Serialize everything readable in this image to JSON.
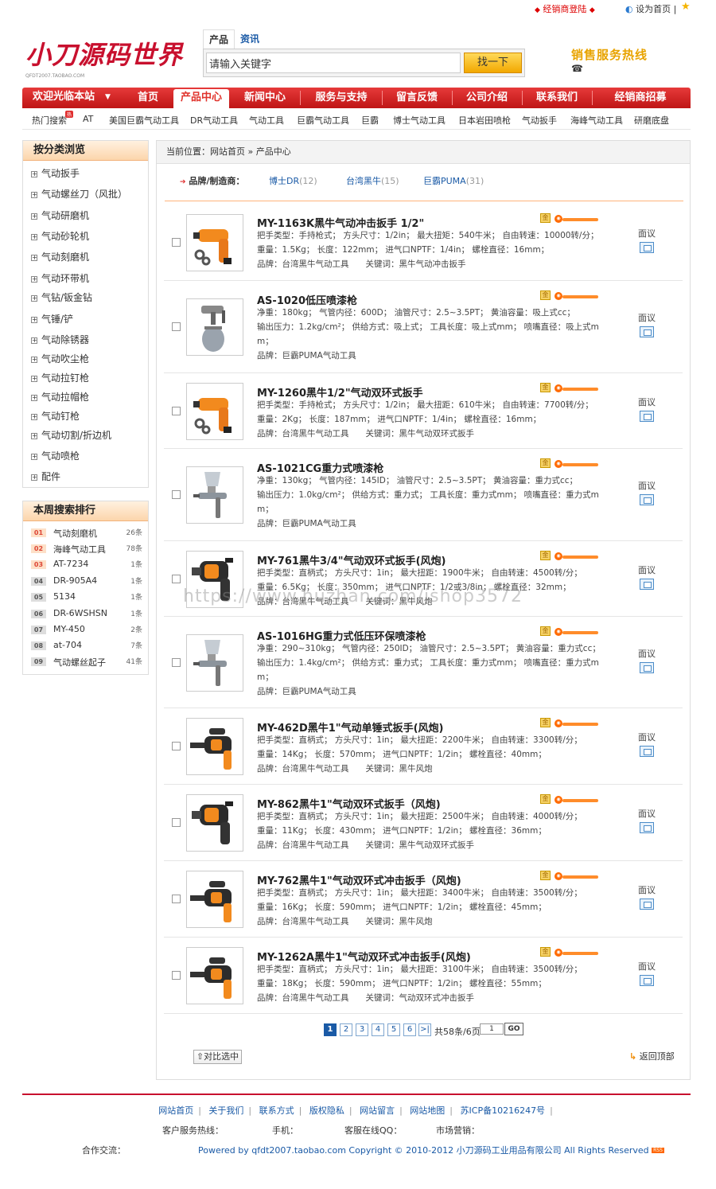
{
  "topbar": {
    "dealer": "经销商登陆",
    "set_home": "设为首页",
    "sep": "|"
  },
  "logo": {
    "title": "小刀源码世界",
    "sub": "QFDT2007.TAOBAO.COM"
  },
  "search": {
    "tab_product": "产品",
    "tab_news": "资讯",
    "placeholder": "请输入关键字",
    "button": "找一下"
  },
  "hotline": {
    "label": "销售服务热线"
  },
  "nav": {
    "welcome": "欢迎光临本站",
    "items": [
      "首页",
      "产品中心",
      "新闻中心",
      "服务与支持",
      "留言反馈",
      "公司介绍",
      "联系我们",
      "经销商招募"
    ]
  },
  "hot_search": {
    "label": "热门搜索",
    "badge": "热",
    "keywords": [
      "AT",
      "美国巨霸气动工具",
      "DR气动工具",
      "气动工具",
      "巨霸气动工具",
      "巨霸",
      "博士气动工具",
      "日本岩田喷枪",
      "气动扳手",
      "海峰气动工具",
      "研磨底盘"
    ]
  },
  "categories": {
    "title": "按分类浏览",
    "items": [
      "气动扳手",
      "气动螺丝刀（风批）",
      "气动研磨机",
      "气动砂轮机",
      "气动刻磨机",
      "气动环带机",
      "气钻/钣金钻",
      "气锤/铲",
      "气动除锈器",
      "气动吹尘枪",
      "气动拉钉枪",
      "气动拉帽枪",
      "气动钉枪",
      "气动切割/折边机",
      "气动喷枪",
      "配件"
    ]
  },
  "ranking": {
    "title": "本周搜索排行",
    "items": [
      {
        "n": "01",
        "w": "气动刻磨机",
        "c": "26条"
      },
      {
        "n": "02",
        "w": "海峰气动工具",
        "c": "78条"
      },
      {
        "n": "03",
        "w": "AT-7234",
        "c": "1条"
      },
      {
        "n": "04",
        "w": "DR-905A4",
        "c": "1条"
      },
      {
        "n": "05",
        "w": "5134",
        "c": "1条"
      },
      {
        "n": "06",
        "w": "DR-6WSHSN",
        "c": "1条"
      },
      {
        "n": "07",
        "w": "MY-450",
        "c": "2条"
      },
      {
        "n": "08",
        "w": "at-704",
        "c": "7条"
      },
      {
        "n": "09",
        "w": "气动螺丝起子",
        "c": "41条"
      }
    ]
  },
  "breadcrumb": "当前位置：网站首页 » 产品中心",
  "brands": {
    "label": "品牌/制造商：",
    "items": [
      {
        "name": "博士DR",
        "count": "(12)"
      },
      {
        "name": "台湾黑牛",
        "count": "(15)"
      },
      {
        "name": "巨霸PUMA",
        "count": "(31)"
      }
    ]
  },
  "products": [
    {
      "title": "MY-1163K黑牛气动冲击扳手 1/2\"",
      "l1": "把手类型：手持枪式； 方头尺寸：1/2in； 最大扭矩：540牛米； 自由转速：10000转/分；",
      "l2": "重量：1.5Kg； 长度：122mm； 进气口NPTF：1/4in； 螺栓直径：16mm；",
      "l3": "",
      "l4": "品牌：台湾黑牛气动工具　　关键词：黑牛气动冲击扳手",
      "mian": "面议",
      "type": "wrench"
    },
    {
      "title": "AS-1020低压喷漆枪",
      "l1": "净重：180kg； 气管内径：600D； 油管尺寸：2.5~3.5PT； 黄油容量：吸上式cc；",
      "l2": "输出压力：1.2kg/cm²； 供给方式：吸上式； 工具长度：吸上式mm； 喷嘴直径：吸上式m",
      "l3": "m；",
      "l4": "品牌：巨霸PUMA气动工具",
      "mian": "面议",
      "type": "gun-low"
    },
    {
      "title": "MY-1260黑牛1/2\"气动双环式扳手",
      "l1": "把手类型：手持枪式； 方头尺寸：1/2in； 最大扭距：610牛米； 自由转速：7700转/分；",
      "l2": "重量：2Kg； 长度：187mm； 进气口NPTF：1/4in； 螺栓直径：16mm；",
      "l3": "",
      "l4": "品牌：台湾黑牛气动工具　　关键词：黑牛气动双环式扳手",
      "mian": "面议",
      "type": "wrench"
    },
    {
      "title": "AS-1021CG重力式喷漆枪",
      "l1": "净重：130kg； 气管内径：145ID； 油管尺寸：2.5~3.5PT； 黄油容量：重力式cc；",
      "l2": "输出压力：1.0kg/cm²； 供给方式：重力式； 工具长度：重力式mm； 喷嘴直径：重力式m",
      "l3": "m；",
      "l4": "品牌：巨霸PUMA气动工具",
      "mian": "面议",
      "type": "gun-high"
    },
    {
      "title": "MY-761黑牛3/4\"气动双环式扳手(风炮)",
      "l1": "把手类型：直柄式； 方头尺寸：1in； 最大扭距：1900牛米； 自由转速：4500转/分；",
      "l2": "重量：6.5Kg； 长度：350mm； 进气口NPTF：1/2或3/8in； 螺栓直径：32mm；",
      "l3": "",
      "l4": "品牌：台湾黑牛气动工具　　关键词：黑牛风炮",
      "mian": "面议",
      "type": "big"
    },
    {
      "title": "AS-1016HG重力式低压环保喷漆枪",
      "l1": "净重：290~310kg； 气管内径：250ID； 油管尺寸：2.5~3.5PT； 黄油容量：重力式cc；",
      "l2": "输出压力：1.4kg/cm²； 供给方式：重力式； 工具长度：重力式mm； 喷嘴直径：重力式m",
      "l3": "m；",
      "l4": "品牌：巨霸PUMA气动工具",
      "mian": "面议",
      "type": "gun-high"
    },
    {
      "title": "MY-462D黑牛1\"气动单锤式扳手(风炮)",
      "l1": "把手类型：直柄式； 方头尺寸：1in； 最大扭距：2200牛米； 自由转速：3300转/分；",
      "l2": "重量：14Kg； 长度：570mm； 进气口NPTF：1/2in； 螺栓直径：40mm；",
      "l3": "",
      "l4": "品牌：台湾黑牛气动工具　　关键词：黑牛风炮",
      "mian": "面议",
      "type": "long"
    },
    {
      "title": "MY-862黑牛1\"气动双环式扳手（风炮)",
      "l1": "把手类型：直柄式； 方头尺寸：1in； 最大扭距：2500牛米； 自由转速：4000转/分；",
      "l2": "重量：11Kg； 长度：430mm； 进气口NPTF：1/2in； 螺栓直径：36mm；",
      "l3": "",
      "l4": "品牌：台湾黑牛气动工具　　关键词：黑牛气动双环式扳手",
      "mian": "面议",
      "type": "big"
    },
    {
      "title": "MY-762黑牛1\"气动双环式冲击扳手（风炮)",
      "l1": "把手类型：直柄式； 方头尺寸：1in； 最大扭距：3400牛米； 自由转速：3500转/分；",
      "l2": "重量：16Kg； 长度：590mm； 进气口NPTF：1/2in； 螺栓直径：45mm；",
      "l3": "",
      "l4": "品牌：台湾黑牛气动工具　　关键词：黑牛风炮",
      "mian": "面议",
      "type": "long"
    },
    {
      "title": "MY-1262A黑牛1\"气动双环式冲击扳手(风炮)",
      "l1": "把手类型：直柄式； 方头尺寸：1in； 最大扭距：3100牛米； 自由转速：3500转/分；",
      "l2": "重量：18Kg； 长度：590mm； 进气口NPTF：1/2in； 螺栓直径：55mm；",
      "l3": "",
      "l4": "品牌：台湾黑牛气动工具　　关键词：气动双环式冲击扳手",
      "mian": "面议",
      "type": "long"
    }
  ],
  "pager": {
    "pages": [
      "1",
      "2",
      "3",
      "4",
      "5",
      "6",
      ">|"
    ],
    "info": "共58条/6页",
    "input": "1",
    "go": "GO"
  },
  "compare": "对比选中",
  "back_top": "返回顶部",
  "footer": {
    "links": [
      "网站首页",
      "关于我们",
      "联系方式",
      "版权隐私",
      "网站留言",
      "网站地图",
      "苏ICP备10216247号"
    ],
    "service": "客户服务热线：",
    "mobile": "手机：",
    "qq": "客服在线QQ：",
    "marketing": "市场营销：",
    "partner": "合作交流：",
    "copyright": "Powered by qfdt2007.taobao.com Copyright © 2010-2012 小刀源码工业用品有限公司 All Rights Reserved",
    "rss": "RSS"
  },
  "watermark": "https://www.huzhan.com/ishop3572",
  "colors": {
    "brand_red": "#c8102e",
    "nav_red": "#d42020",
    "link_blue": "#1a5aa6",
    "accent_orange": "#ff8c2a"
  }
}
